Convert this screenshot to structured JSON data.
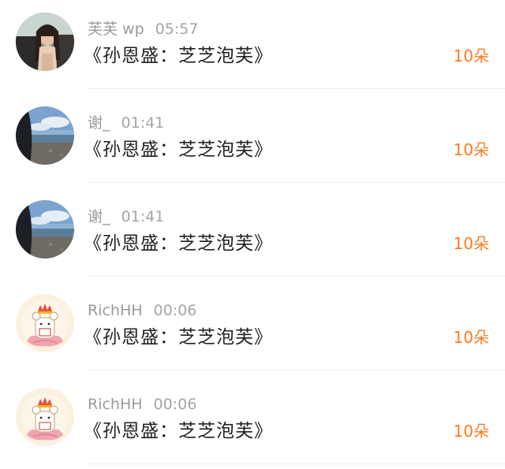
{
  "gifts": [
    {
      "user": "芙芙 wp",
      "time": "05:57",
      "message": "《孙恩盛：芝芝泡芙》",
      "count": "10朵",
      "avatar": "girl-in-car-avatar"
    },
    {
      "user": "谢_",
      "time": "01:41",
      "message": "《孙恩盛：芝芝泡芙》",
      "count": "10朵",
      "avatar": "seaside-avatar"
    },
    {
      "user": "谢_",
      "time": "01:41",
      "message": "《孙恩盛：芝芝泡芙》",
      "count": "10朵",
      "avatar": "seaside-avatar"
    },
    {
      "user": "RichHH",
      "time": "00:06",
      "message": "《孙恩盛：芝芝泡芙》",
      "count": "10朵",
      "avatar": "bear-on-lotus-avatar"
    },
    {
      "user": "RichHH",
      "time": "00:06",
      "message": "《孙恩盛：芝芝泡芙》",
      "count": "10朵",
      "avatar": "bear-on-lotus-avatar"
    }
  ],
  "colors": {
    "count": "#ff7a1f",
    "meta": "#9a9a9a",
    "message": "#222222"
  }
}
